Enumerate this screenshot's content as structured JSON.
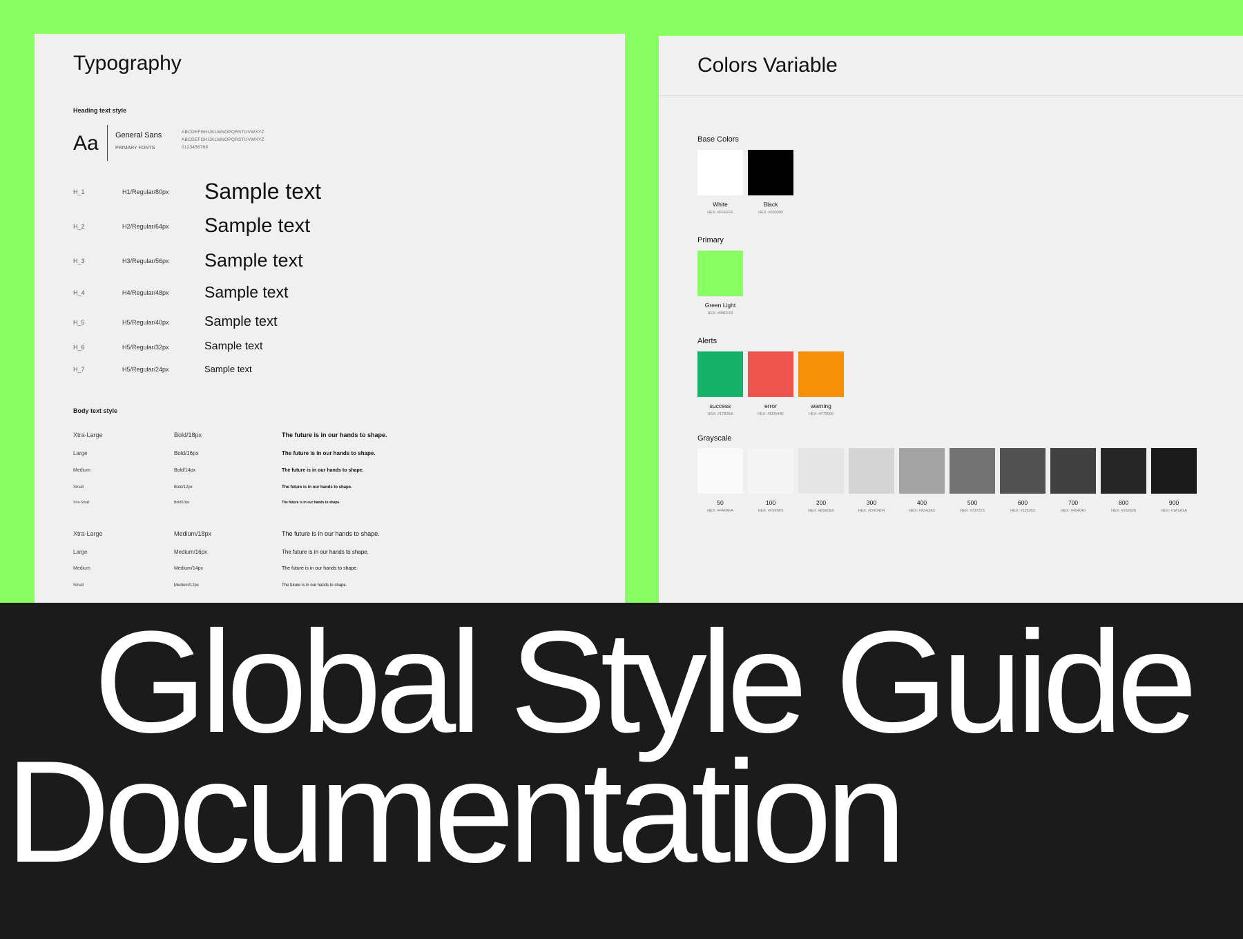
{
  "typography": {
    "title": "Typography",
    "heading_section_label": "Heading text style",
    "font_card": {
      "sample": "Aa",
      "name": "General Sans",
      "subtitle": "PRIMARY FONTS",
      "uppercase": "ABCDEFGHIJKLMNOPQRSTUVWXYZ",
      "lowercase": "ABCDEFGHIJKLMNOPQRSTUVWXYZ",
      "digits": "0123456789"
    },
    "headings": [
      {
        "id": "H_1",
        "spec": "H1/Regular/80px",
        "sample": "Sample text"
      },
      {
        "id": "H_2",
        "spec": "H2/Regular/64px",
        "sample": "Sample text"
      },
      {
        "id": "H_3",
        "spec": "H3/Regular/56px",
        "sample": "Sample text"
      },
      {
        "id": "H_4",
        "spec": "H4/Regular/48px",
        "sample": "Sample text"
      },
      {
        "id": "H_5",
        "spec": "H5/Regular/40px",
        "sample": "Sample text"
      },
      {
        "id": "H_6",
        "spec": "H5/Regular/32px",
        "sample": "Sample text"
      },
      {
        "id": "H_7",
        "spec": "H5/Regular/24px",
        "sample": "Sample text"
      }
    ],
    "body_section_label": "Body text style",
    "body_bold": [
      {
        "size": "Xtra-Large",
        "spec": "Bold/18px",
        "text": "The future is in our hands to shape."
      },
      {
        "size": "Large",
        "spec": "Bold/16px",
        "text": "The future is in our hands to shape."
      },
      {
        "size": "Medium",
        "spec": "Bold/14px",
        "text": "The future is in our hands to shape."
      },
      {
        "size": "Small",
        "spec": "Bold/12px",
        "text": "The future is in our hands to shape."
      },
      {
        "size": "Xtra-Small",
        "spec": "Bold/10px",
        "text": "The future is in our hands to shape."
      }
    ],
    "body_medium": [
      {
        "size": "Xtra-Large",
        "spec": "Medium/18px",
        "text": "The future is in our hands to shape."
      },
      {
        "size": "Large",
        "spec": "Medium/16px",
        "text": "The future is in our hands to shape."
      },
      {
        "size": "Medium",
        "spec": "Medium/14px",
        "text": "The future is in our hands to shape."
      },
      {
        "size": "Small",
        "spec": "Medium/12px",
        "text": "The future is in our hands to shape."
      }
    ]
  },
  "colors": {
    "title": "Colors Variable",
    "groups": {
      "base": {
        "label": "Base Colors",
        "swatches": [
          {
            "name": "White",
            "hex": "HEX: #FFFFFF",
            "color": "#FFFFFF"
          },
          {
            "name": "Black",
            "hex": "HEX: #000000",
            "color": "#000000"
          }
        ]
      },
      "primary": {
        "label": "Primary",
        "swatches": [
          {
            "name": "Green Light",
            "hex": "HEX: #8AFF63",
            "color": "#8AFF63"
          }
        ]
      },
      "alerts": {
        "label": "Alerts",
        "swatches": [
          {
            "name": "success",
            "hex": "HEX: #17B26A",
            "color": "#17B26A"
          },
          {
            "name": "error",
            "hex": "HEX: #ED544E",
            "color": "#ED544E"
          },
          {
            "name": "warning",
            "hex": "HEX: #F79009",
            "color": "#F79009"
          }
        ]
      },
      "grayscale": {
        "label": "Grayscale",
        "swatches": [
          {
            "name": "50",
            "hex": "HEX: #FAFAFA",
            "color": "#FAFAFA"
          },
          {
            "name": "100",
            "hex": "HEX: #F5F5F5",
            "color": "#F5F5F5"
          },
          {
            "name": "200",
            "hex": "HEX: #E5E5E5",
            "color": "#E5E5E5"
          },
          {
            "name": "300",
            "hex": "HEX: #D4D4D4",
            "color": "#D4D4D4"
          },
          {
            "name": "400",
            "hex": "HEX: #A3A3A3",
            "color": "#A3A3A3"
          },
          {
            "name": "500",
            "hex": "HEX: #737373",
            "color": "#737373"
          },
          {
            "name": "600",
            "hex": "HEX: #525252",
            "color": "#525252"
          },
          {
            "name": "700",
            "hex": "HEX: #404040",
            "color": "#404040"
          },
          {
            "name": "800",
            "hex": "HEX: #262626",
            "color": "#262626"
          },
          {
            "name": "900",
            "hex": "HEX: #1A1A1A",
            "color": "#1A1A1A"
          }
        ]
      }
    }
  },
  "hero": {
    "line1": "Global Style Guide",
    "line2": "Documentation"
  },
  "theme": {
    "background": "#8AFF63",
    "panel": "#F0F0F0",
    "hero_background": "#1B1B1B",
    "hero_text": "#FFFFFF"
  }
}
